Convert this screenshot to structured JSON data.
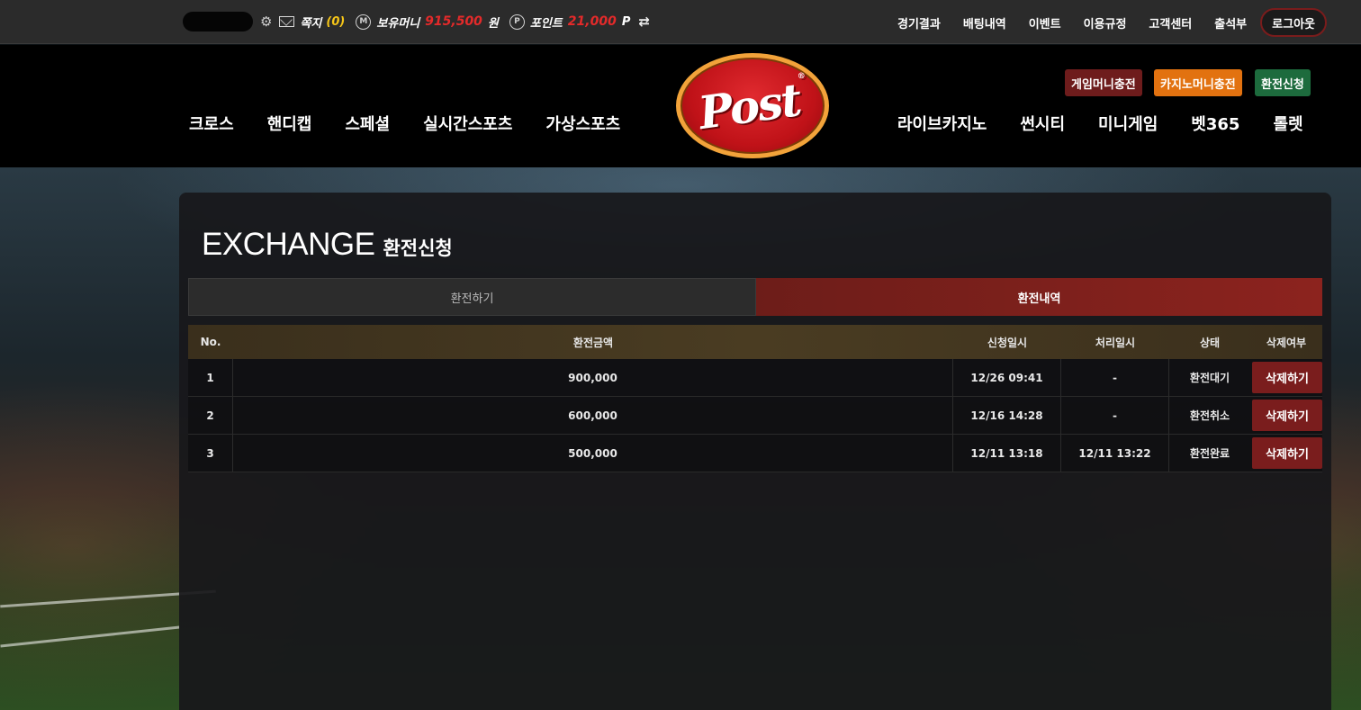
{
  "topbar": {
    "messages_label": "쪽지",
    "messages_count": "(0)",
    "money_label": "보유머니",
    "money_value": "915,500",
    "money_unit": "원",
    "points_label": "포인트",
    "points_value": "21,000",
    "points_unit": "P",
    "money_icon_letter": "M",
    "points_icon_letter": "P",
    "links": [
      "경기결과",
      "배팅내역",
      "이벤트",
      "이용규정",
      "고객센터",
      "출석부"
    ],
    "logout_label": "로그아웃"
  },
  "header": {
    "logo_text": "Post",
    "logo_reg": "®",
    "nav_left": [
      "크로스",
      "핸디캡",
      "스페셜",
      "실시간스포츠",
      "가상스포츠"
    ],
    "nav_right": [
      "라이브카지노",
      "썬시티",
      "미니게임",
      "벳365",
      "롤렛"
    ],
    "charge_buttons": [
      "게임머니충전",
      "카지노머니충전",
      "환전신청"
    ]
  },
  "page": {
    "title_en": "EXCHANGE",
    "title_ko": "환전신청",
    "tabs": [
      "환전하기",
      "환전내역"
    ],
    "active_tab": 1
  },
  "table": {
    "headers": [
      "No.",
      "환전금액",
      "신청일시",
      "처리일시",
      "상태",
      "삭제여부"
    ],
    "rows": [
      {
        "no": "1",
        "amount": "900,000",
        "requested": "12/26 09:41",
        "processed": "-",
        "status": "환전대기",
        "action": "삭제하기"
      },
      {
        "no": "2",
        "amount": "600,000",
        "requested": "12/16 14:28",
        "processed": "-",
        "status": "환전취소",
        "action": "삭제하기"
      },
      {
        "no": "3",
        "amount": "500,000",
        "requested": "12/11 13:18",
        "processed": "12/11 13:22",
        "status": "환전완료",
        "action": "삭제하기"
      }
    ]
  },
  "colors": {
    "accent_red": "#7a1d1d",
    "charge_game": "#6e1c1c",
    "charge_casino": "#e27210",
    "charge_exchange": "#1d6b3d",
    "money_value": "#e42a2a",
    "message_count": "#f5c518"
  },
  "icons": {
    "settings": "gear-icon",
    "messages": "mail-icon",
    "money": "money-m-icon",
    "points": "points-p-icon",
    "refresh": "refresh-icon"
  }
}
